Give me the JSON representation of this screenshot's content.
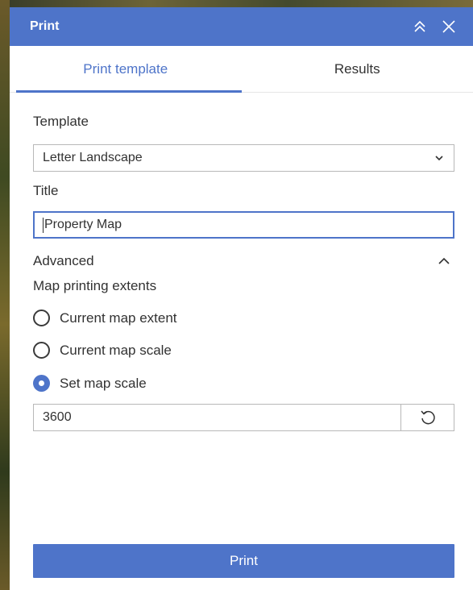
{
  "header": {
    "title": "Print",
    "collapse_icon": "double-chevron-up-icon",
    "close_icon": "close-icon"
  },
  "tabs": [
    {
      "label": "Print template",
      "active": true
    },
    {
      "label": "Results",
      "active": false
    }
  ],
  "form": {
    "template_label": "Template",
    "template_value": "Letter Landscape",
    "title_label": "Title",
    "title_value": "Property Map",
    "advanced_label": "Advanced",
    "advanced_expanded": true,
    "extents_label": "Map printing extents",
    "extent_options": [
      {
        "label": "Current map extent",
        "checked": false
      },
      {
        "label": "Current map scale",
        "checked": false
      },
      {
        "label": "Set map scale",
        "checked": true
      }
    ],
    "scale_value": "3600"
  },
  "print_button": "Print",
  "colors": {
    "accent": "#4e74c9",
    "text": "#323232",
    "border": "#b8b8b8"
  }
}
